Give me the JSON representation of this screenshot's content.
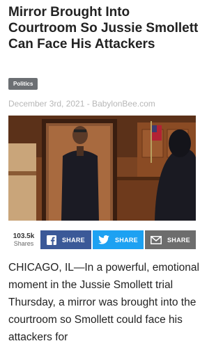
{
  "article": {
    "title": "Mirror Brought Into Courtroom So Jussie Smollett Can Face His Attackers",
    "category": "Politics",
    "date_source": "December 3rd, 2021 - BabylonBee.com",
    "body": "CHICAGO, IL—In a powerful, emotional moment in the Jussie Smollett trial Thursday, a mirror was brought into the courtroom so Smollett could face his attackers for"
  },
  "share": {
    "count": "103.5k",
    "count_label": "Shares",
    "buttons": [
      {
        "label": "SHARE",
        "icon": "facebook-icon",
        "color": "#3b5998"
      },
      {
        "label": "SHARE",
        "icon": "twitter-icon",
        "color": "#1da1f2"
      },
      {
        "label": "SHARE",
        "icon": "email-icon",
        "color": "#6d6d6d"
      }
    ]
  }
}
